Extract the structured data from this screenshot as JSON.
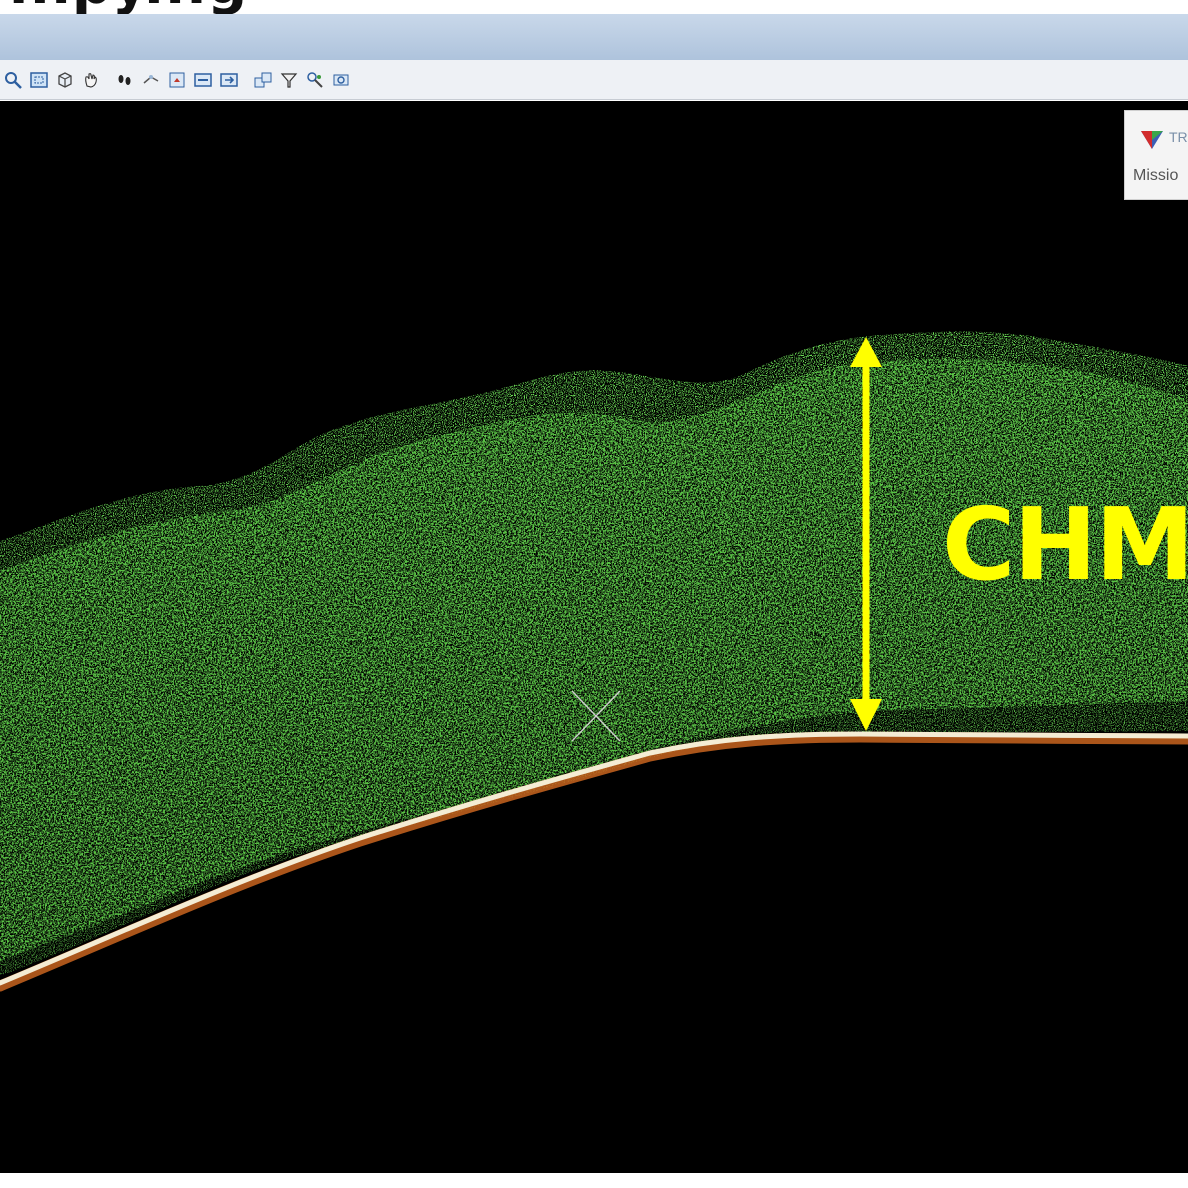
{
  "slide": {
    "title_partial": "...py...g"
  },
  "toolbar": {
    "buttons": [
      "zoom-icon",
      "fit-view-icon",
      "cube-view-icon",
      "pan-hand-icon",
      "walk-icon",
      "measure-icon",
      "select-icon",
      "layer-icon",
      "layer-next-icon",
      "section-icon",
      "filter-icon",
      "classify-icon",
      "settings-icon"
    ]
  },
  "popup": {
    "app_name": "TR",
    "text": "Missio"
  },
  "annotation": {
    "label": "CHM",
    "color": "#ffff00"
  },
  "colors": {
    "canopy": "#2fbf1f",
    "ground": "#f0e6c8",
    "background": "#000000"
  }
}
